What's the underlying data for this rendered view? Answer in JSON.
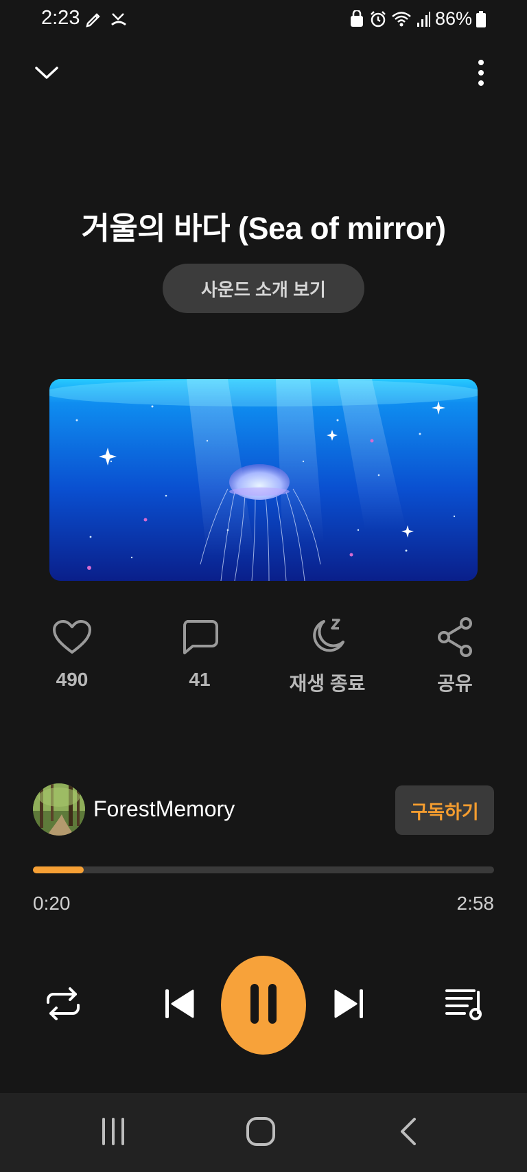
{
  "status_bar": {
    "time": "2:23",
    "battery": "86%"
  },
  "header": {
    "collapse_icon": "chevron-down-icon",
    "menu_icon": "more-vertical-icon"
  },
  "track": {
    "title": "거울의 바다 (Sea of mirror)",
    "intro_button": "사운드 소개 보기"
  },
  "actions": {
    "likes": "490",
    "comments": "41",
    "sleep_timer": "재생 종료",
    "share": "공유"
  },
  "artist": {
    "name": "ForestMemory",
    "subscribe_button": "구독하기"
  },
  "playback": {
    "elapsed": "0:20",
    "duration": "2:58",
    "progress": 0.11
  },
  "colors": {
    "accent": "#f7a23a",
    "background": "#161616"
  }
}
